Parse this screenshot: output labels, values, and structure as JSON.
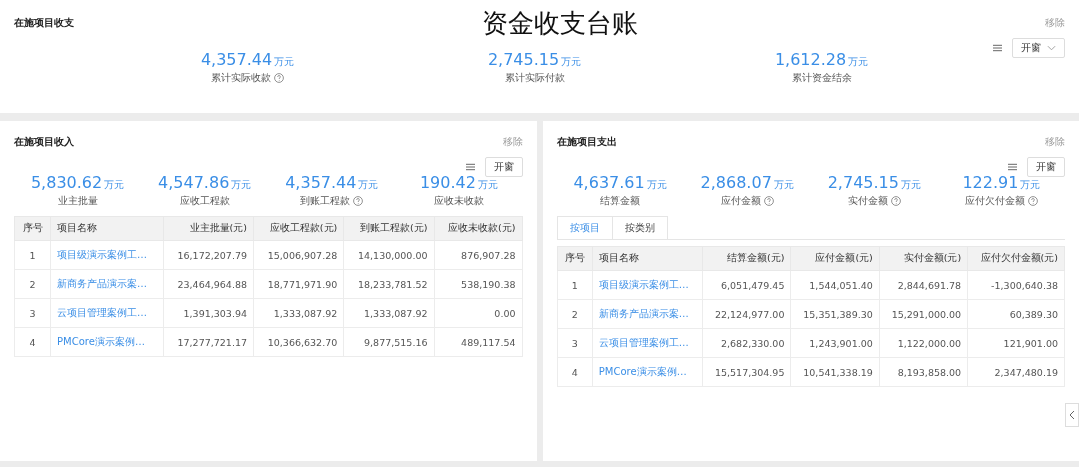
{
  "page_title": "资金收支台账",
  "overview": {
    "title": "在施项目收支",
    "remove": "移除",
    "toggle": "开窗",
    "metrics": [
      {
        "value": "4,357.44",
        "unit": "万元",
        "label": "累计实际收款",
        "help": true
      },
      {
        "value": "2,745.15",
        "unit": "万元",
        "label": "累计实际付款",
        "help": false
      },
      {
        "value": "1,612.28",
        "unit": "万元",
        "label": "累计资金结余",
        "help": false
      }
    ]
  },
  "panels": [
    {
      "title": "在施项目收入",
      "remove": "移除",
      "toggle": "开窗",
      "metrics": [
        {
          "value": "5,830.62",
          "unit": "万元",
          "label": "业主批量",
          "help": false
        },
        {
          "value": "4,547.86",
          "unit": "万元",
          "label": "应收工程款",
          "help": false
        },
        {
          "value": "4,357.44",
          "unit": "万元",
          "label": "到账工程款",
          "help": true
        },
        {
          "value": "190.42",
          "unit": "万元",
          "label": "应收未收款",
          "help": false
        }
      ],
      "table": {
        "columns": [
          "序号",
          "项目名称",
          "业主批量(元)",
          "应收工程款(元)",
          "到账工程款(元)",
          "应收未收款(元)"
        ],
        "rows": [
          [
            "1",
            "项目级演示案例工…",
            "16,172,207.79",
            "15,006,907.28",
            "14,130,000.00",
            "876,907.28"
          ],
          [
            "2",
            "新商务产品演示案…",
            "23,464,964.88",
            "18,771,971.90",
            "18,233,781.52",
            "538,190.38"
          ],
          [
            "3",
            "云项目管理案例工…",
            "1,391,303.94",
            "1,333,087.92",
            "1,333,087.92",
            "0.00"
          ],
          [
            "4",
            "PMCore演示案例…",
            "17,277,721.17",
            "10,366,632.70",
            "9,877,515.16",
            "489,117.54"
          ]
        ]
      }
    },
    {
      "title": "在施项目支出",
      "remove": "移除",
      "toggle": "开窗",
      "metrics": [
        {
          "value": "4,637.61",
          "unit": "万元",
          "label": "结算金额",
          "help": false
        },
        {
          "value": "2,868.07",
          "unit": "万元",
          "label": "应付金额",
          "help": true
        },
        {
          "value": "2,745.15",
          "unit": "万元",
          "label": "实付金额",
          "help": true
        },
        {
          "value": "122.91",
          "unit": "万元",
          "label": "应付欠付金额",
          "help": true
        }
      ],
      "tabs": [
        {
          "label": "按项目",
          "selected": true
        },
        {
          "label": "按类别",
          "selected": false
        }
      ],
      "table": {
        "columns": [
          "序号",
          "项目名称",
          "结算金额(元)",
          "应付金额(元)",
          "实付金额(元)",
          "应付欠付金额(元)"
        ],
        "rows": [
          [
            "1",
            "项目级演示案例工…",
            "6,051,479.45",
            "1,544,051.40",
            "2,844,691.78",
            "-1,300,640.38"
          ],
          [
            "2",
            "新商务产品演示案…",
            "22,124,977.00",
            "15,351,389.30",
            "15,291,000.00",
            "60,389.30"
          ],
          [
            "3",
            "云项目管理案例工…",
            "2,682,330.00",
            "1,243,901.00",
            "1,122,000.00",
            "121,901.00"
          ],
          [
            "4",
            "PMCore演示案例…",
            "15,517,304.95",
            "10,541,338.19",
            "8,193,858.00",
            "2,347,480.19"
          ]
        ]
      }
    }
  ]
}
